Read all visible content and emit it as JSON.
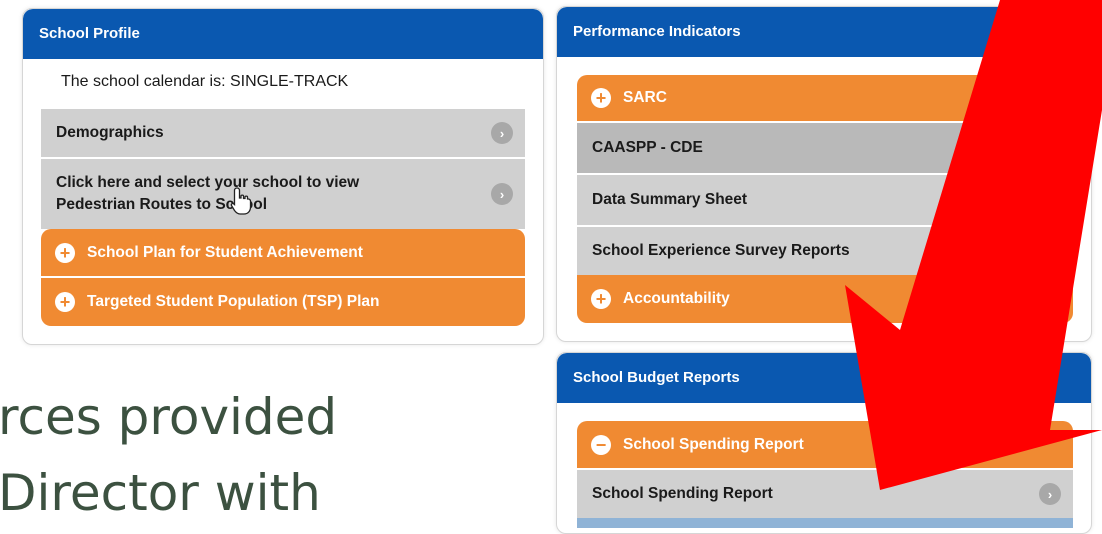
{
  "school_profile": {
    "title": "School Profile",
    "calendar_text": "The school calendar is: SINGLE-TRACK",
    "demographics_label": "Demographics",
    "routes_line1": "Click here and select your school to view",
    "routes_line2": "Pedestrian Routes to School",
    "plan_label": "School Plan for Student Achievement",
    "tsp_label": "Targeted Student Population (TSP) Plan"
  },
  "performance": {
    "title": "Performance Indicators",
    "sarc_label": "SARC",
    "caaspp_label": "CAASPP - CDE",
    "data_summary_label": "Data Summary Sheet",
    "survey_label": "School Experience Survey Reports",
    "accountability_label": "Accountability"
  },
  "budget": {
    "title": "School Budget Reports",
    "spending_header_label": "School Spending Report",
    "spending_item_label": "School Spending Report"
  },
  "caption": {
    "line1": "rces provided",
    "line2": "Director with"
  },
  "icons": {
    "expand": "plus-circle-icon",
    "collapse": "minus-circle-icon",
    "navigate": "chevron-right-icon",
    "pointer": "hand-cursor-icon",
    "annotation": "red-arrow-icon"
  },
  "colors": {
    "header_blue": "#0a58b0",
    "accordion_orange": "#f08a32",
    "row_grey": "#d0d0d0",
    "arrow_red": "#ff0000",
    "caption_green": "#3c5140"
  }
}
